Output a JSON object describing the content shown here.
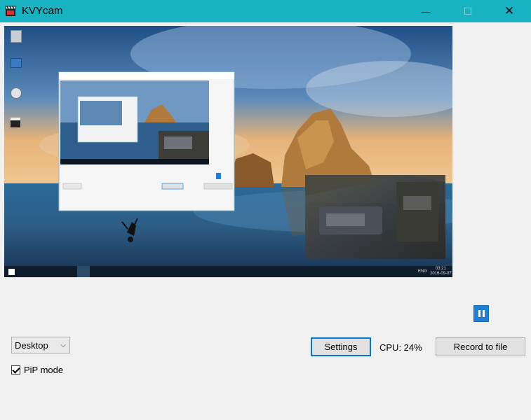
{
  "window": {
    "title": "KVYcam",
    "minimize_glyph": "—",
    "maximize_glyph": "☐",
    "close_glyph": "✕"
  },
  "preview": {
    "desktop_icons": [
      "recycle-bin-icon",
      "network-icon",
      "google-chrome-icon",
      "kvycam-icon"
    ],
    "taskbar": {
      "time": "03:21",
      "date": "2016-09-07",
      "lang": "ENG"
    }
  },
  "controls": {
    "pause_icon": "pause-icon",
    "source_select": {
      "value": "Desktop"
    },
    "settings_label": "Settings",
    "cpu_text": "CPU: 24%",
    "record_label": "Record to file",
    "pip_mode": {
      "label": "PiP mode",
      "checked": true
    }
  },
  "colors": {
    "titlebar": "#17b3c2",
    "accent": "#0078d7",
    "pause_button": "#1e7fd6"
  }
}
